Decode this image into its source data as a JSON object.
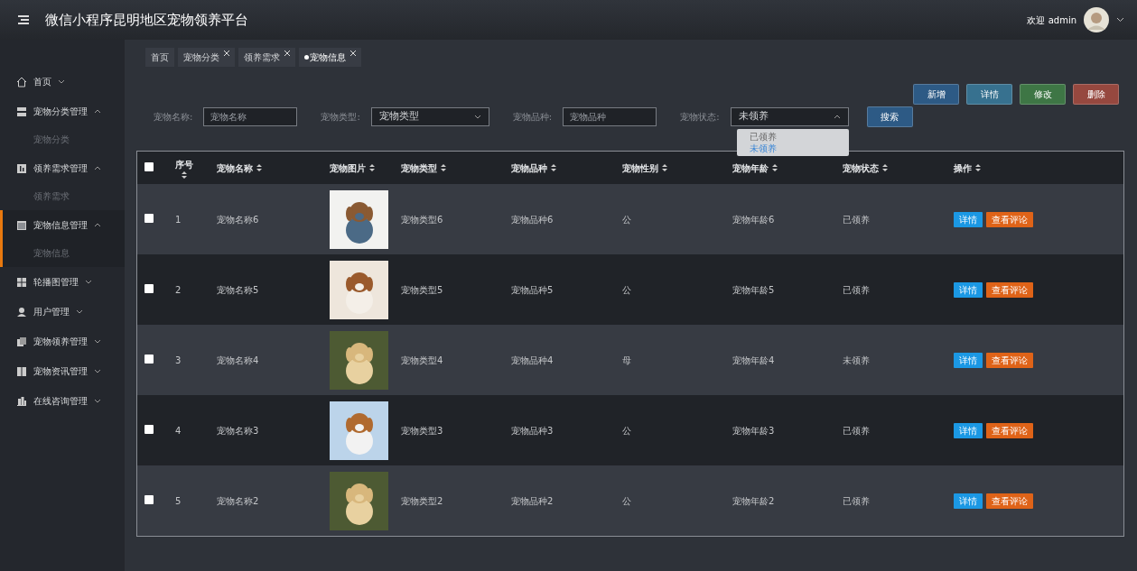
{
  "header": {
    "title": "微信小程序昆明地区宠物领养平台",
    "welcome": "欢迎 admin"
  },
  "sidebar": {
    "items": [
      {
        "label": "首页",
        "expanded": false,
        "selected": false
      },
      {
        "label": "宠物分类管理",
        "expanded": true,
        "selected": false,
        "children": [
          {
            "label": "宠物分类"
          }
        ]
      },
      {
        "label": "领养需求管理",
        "expanded": true,
        "selected": false,
        "children": [
          {
            "label": "领养需求"
          }
        ]
      },
      {
        "label": "宠物信息管理",
        "expanded": true,
        "selected": true,
        "children": [
          {
            "label": "宠物信息"
          }
        ]
      },
      {
        "label": "轮播图管理",
        "expanded": false,
        "selected": false
      },
      {
        "label": "用户管理",
        "expanded": false,
        "selected": false
      },
      {
        "label": "宠物领养管理",
        "expanded": false,
        "selected": false
      },
      {
        "label": "宠物资讯管理",
        "expanded": false,
        "selected": false
      },
      {
        "label": "在线咨询管理",
        "expanded": false,
        "selected": false
      }
    ]
  },
  "tabs": [
    {
      "label": "首页",
      "selected": false,
      "closable": false
    },
    {
      "label": "宠物分类",
      "selected": false,
      "closable": true
    },
    {
      "label": "领养需求",
      "selected": false,
      "closable": true
    },
    {
      "label": "宠物信息",
      "selected": true,
      "closable": true
    }
  ],
  "toolbar": {
    "buttons": [
      {
        "label": "新增",
        "color": "#2d5a85"
      },
      {
        "label": "详情",
        "color": "#37718f"
      },
      {
        "label": "修改",
        "color": "#3e7645"
      },
      {
        "label": "删除",
        "color": "#96483f"
      }
    ]
  },
  "search": {
    "fields": [
      {
        "kind": "input",
        "label": "宠物名称:",
        "placeholder": "宠物名称"
      },
      {
        "kind": "select",
        "label": "宠物类型:",
        "value": "宠物类型",
        "expanded": false
      },
      {
        "kind": "input",
        "label": "宠物品种:",
        "placeholder": "宠物品种"
      },
      {
        "kind": "select",
        "label": "宠物状态:",
        "value": "未领养",
        "expanded": true,
        "options": [
          {
            "label": "已领养",
            "selected": false
          },
          {
            "label": "未领养",
            "selected": true
          }
        ]
      }
    ],
    "button": "搜索"
  },
  "table": {
    "all_checked": false,
    "columns": [
      "序号",
      "宠物名称",
      "宠物图片",
      "宠物类型",
      "宠物品种",
      "宠物性别",
      "宠物年龄",
      "宠物状态",
      "操作"
    ],
    "rows": [
      {
        "checked": false,
        "no": "1",
        "name": "宠物名称6",
        "type": "宠物类型6",
        "breed": "宠物品种6",
        "gender": "公",
        "age": "宠物年龄6",
        "status": "已领养",
        "actions": [
          "详情",
          "查看评论"
        ]
      },
      {
        "checked": false,
        "no": "2",
        "name": "宠物名称5",
        "type": "宠物类型5",
        "breed": "宠物品种5",
        "gender": "公",
        "age": "宠物年龄5",
        "status": "已领养",
        "actions": [
          "详情",
          "查看评论"
        ]
      },
      {
        "checked": false,
        "no": "3",
        "name": "宠物名称4",
        "type": "宠物类型4",
        "breed": "宠物品种4",
        "gender": "母",
        "age": "宠物年龄4",
        "status": "未领养",
        "actions": [
          "详情",
          "查看评论"
        ]
      },
      {
        "checked": false,
        "no": "4",
        "name": "宠物名称3",
        "type": "宠物类型3",
        "breed": "宠物品种3",
        "gender": "公",
        "age": "宠物年龄3",
        "status": "已领养",
        "actions": [
          "详情",
          "查看评论"
        ]
      },
      {
        "checked": false,
        "no": "5",
        "name": "宠物名称2",
        "type": "宠物类型2",
        "breed": "宠物品种2",
        "gender": "公",
        "age": "宠物年龄2",
        "status": "已领养",
        "actions": [
          "详情",
          "查看评论"
        ]
      }
    ]
  }
}
